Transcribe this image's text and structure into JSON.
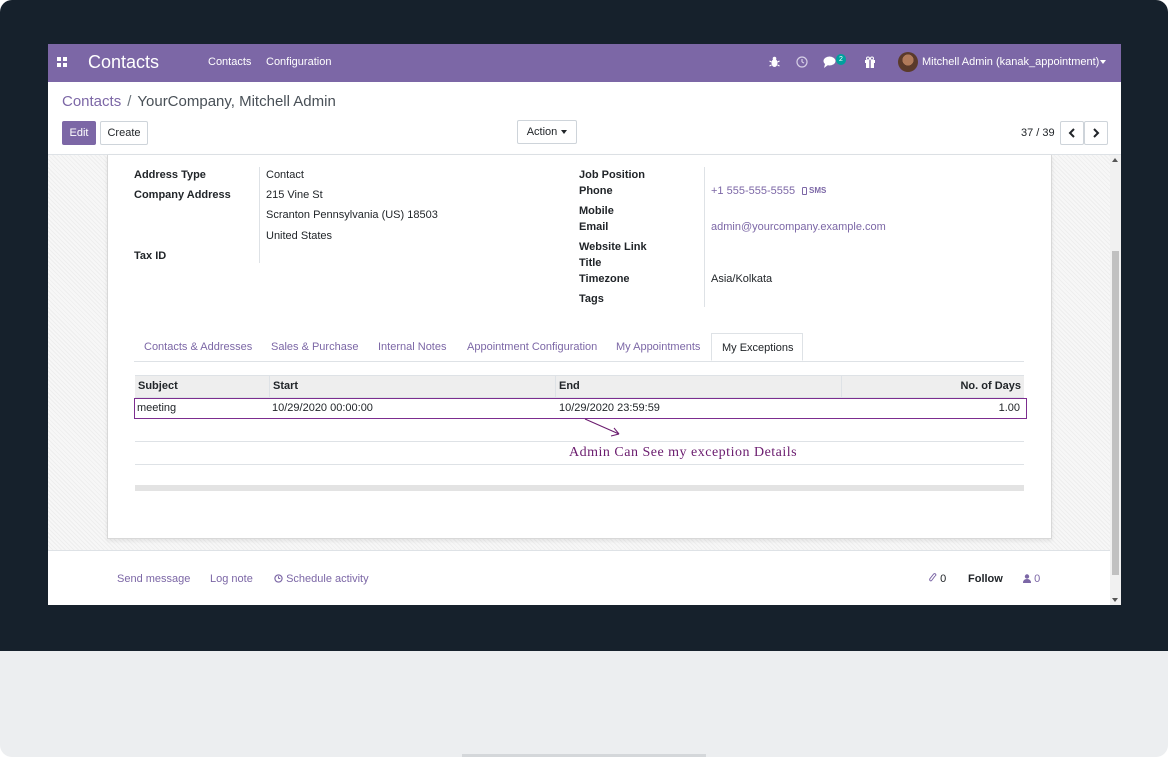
{
  "navbar": {
    "app_title": "Contacts",
    "menu": [
      "Contacts",
      "Configuration"
    ],
    "icons": [
      "bug-icon",
      "clock-icon",
      "chat-icon",
      "gift-icon"
    ],
    "chat_count": "2",
    "user": "Mitchell Admin (kanak_appointment)",
    "color": "#7c67a6"
  },
  "breadcrumb": {
    "parent": "Contacts",
    "separator": "/",
    "current": "YourCompany, Mitchell Admin"
  },
  "controls": {
    "edit": "Edit",
    "create": "Create",
    "action": "Action",
    "pager": "37 / 39"
  },
  "form": {
    "address_type_label": "Address Type",
    "address_type": "Contact",
    "company_address_label": "Company Address",
    "street": "215 Vine St",
    "city_line": "Scranton  Pennsylvania (US)  18503",
    "country": "United States",
    "tax_id_label": "Tax ID",
    "job_position_label": "Job Position",
    "phone_label": "Phone",
    "phone": "+1 555-555-5555",
    "sms": "SMS",
    "mobile_label": "Mobile",
    "email_label": "Email",
    "email": "admin@yourcompany.example.com",
    "website_label": "Website Link",
    "title_label": "Title",
    "timezone_label": "Timezone",
    "timezone": "Asia/Kolkata",
    "tags_label": "Tags"
  },
  "tabs": [
    "Contacts & Addresses",
    "Sales & Purchase",
    "Internal Notes",
    "Appointment Configuration",
    "My Appointments",
    "My Exceptions"
  ],
  "active_tab": "My Exceptions",
  "exceptions": {
    "columns": [
      "Subject",
      "Start",
      "End",
      "No. of Days"
    ],
    "rows": [
      {
        "subject": "meeting",
        "start": "10/29/2020 00:00:00",
        "end": "10/29/2020 23:59:59",
        "days": "1.00"
      }
    ]
  },
  "annotation": "Admin Can See my exception Details",
  "chatter": {
    "send_message": "Send message",
    "log_note": "Log note",
    "schedule_activity": "Schedule activity",
    "attachments": "0",
    "follow": "Follow",
    "followers": "0"
  }
}
